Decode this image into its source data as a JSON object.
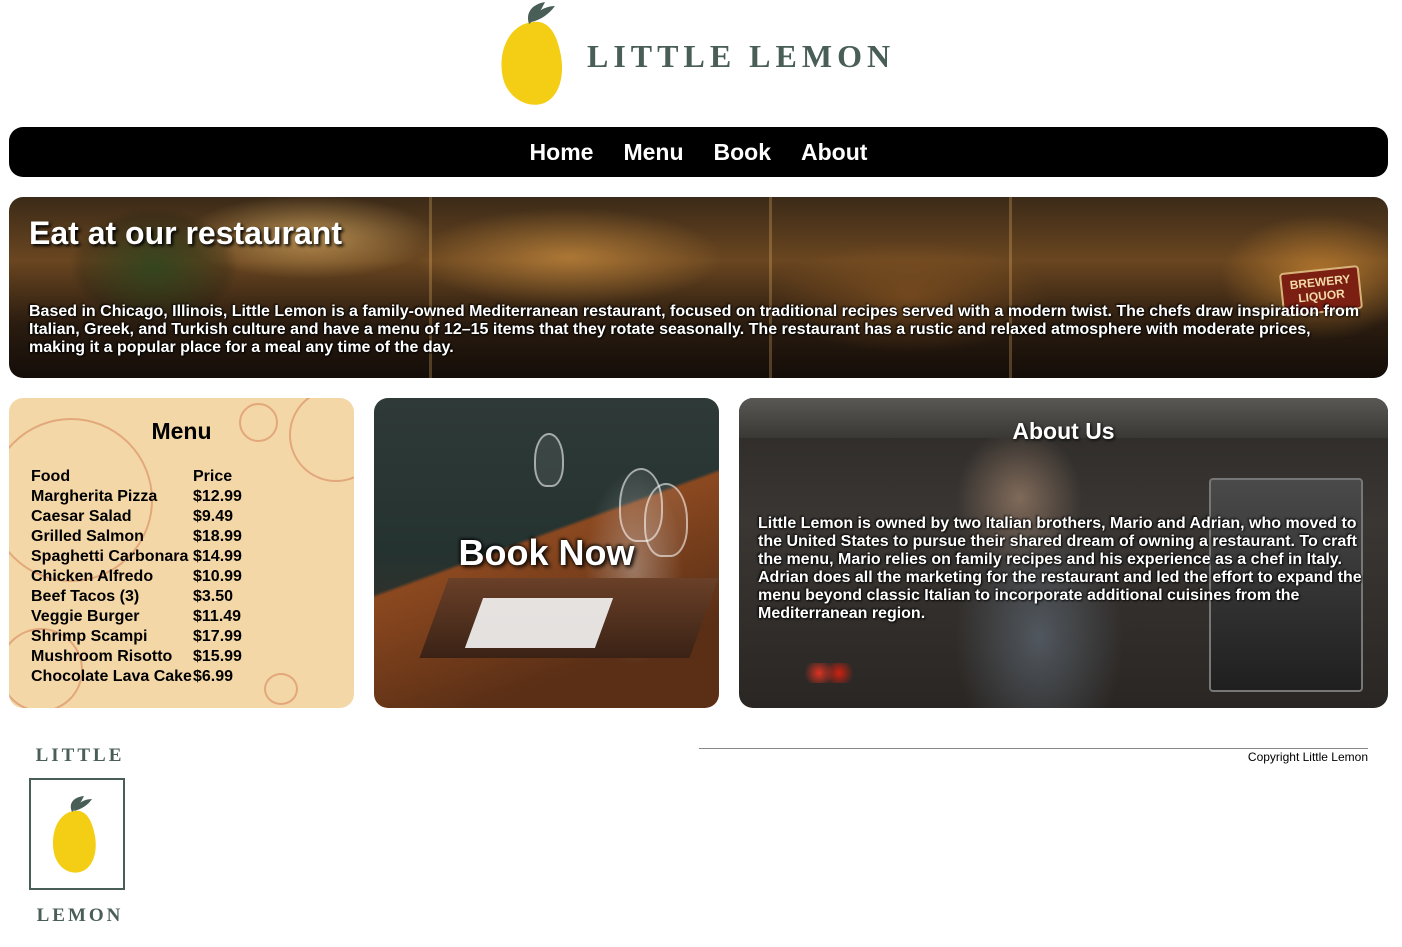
{
  "header": {
    "brand": "LITTLE LEMON"
  },
  "nav": {
    "items": [
      "Home",
      "Menu",
      "Book",
      "About"
    ]
  },
  "hero": {
    "title": "Eat at our restaurant",
    "text": "Based in Chicago, Illinois, Little Lemon is a family-owned Mediterranean restaurant, focused on traditional recipes served with a modern twist. The chefs draw inspiration from Italian, Greek, and Turkish culture and have a menu of 12–15 items that they rotate seasonally. The restaurant has a rustic and relaxed atmosphere with moderate prices, making it a popular place for a meal any time of the day.",
    "sign": "BREWERY LIQUOR"
  },
  "menu": {
    "title": "Menu",
    "headers": [
      "Food",
      "Price"
    ],
    "items": [
      {
        "food": "Margherita Pizza",
        "price": "$12.99"
      },
      {
        "food": "Caesar Salad",
        "price": "$9.49"
      },
      {
        "food": "Grilled Salmon",
        "price": "$18.99"
      },
      {
        "food": "Spaghetti Carbonara",
        "price": "$14.99"
      },
      {
        "food": "Chicken Alfredo",
        "price": "$10.99"
      },
      {
        "food": "Beef Tacos (3)",
        "price": "$3.50"
      },
      {
        "food": "Veggie Burger",
        "price": "$11.49"
      },
      {
        "food": "Shrimp Scampi",
        "price": "$17.99"
      },
      {
        "food": "Mushroom Risotto",
        "price": "$15.99"
      },
      {
        "food": "Chocolate Lava Cake",
        "price": "$6.99"
      }
    ]
  },
  "book": {
    "label": "Book Now"
  },
  "about": {
    "title": "About Us",
    "text": "Little Lemon is owned by two Italian brothers, Mario and Adrian, who moved to the United States to pursue their shared dream of owning a restaurant. To craft the menu, Mario relies on family recipes and his experience as a chef in Italy. Adrian does all the marketing for the restaurant and led the effort to expand the menu beyond classic Italian to incorporate additional cuisines from the Mediterranean region."
  },
  "footer": {
    "logo_top": "LITTLE",
    "logo_bottom": "LEMON",
    "copyright": "Copyright Little Lemon"
  },
  "colors": {
    "brand_green": "#495e57",
    "lemon_yellow": "#f4ce14",
    "nav_bg": "#000000",
    "menu_card_bg": "#f4d7a6"
  },
  "icons": [
    "lemon-logo-icon"
  ]
}
